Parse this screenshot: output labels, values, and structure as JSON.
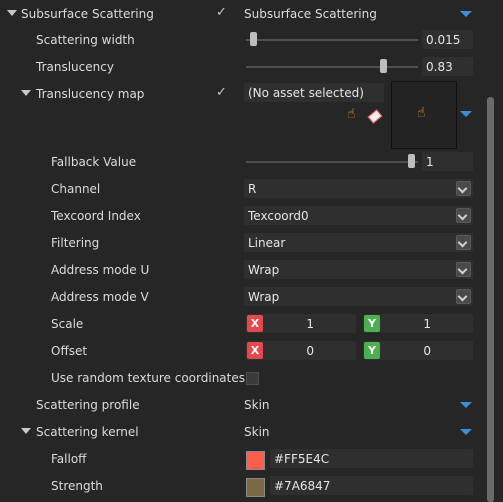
{
  "header": {
    "label": "Subsurface Scattering",
    "dropdown_value": "Subsurface Scattering",
    "checked": true
  },
  "scattering_width": {
    "label": "Scattering width",
    "value": "0.015",
    "slider_fraction": 0.05
  },
  "translucency": {
    "label": "Translucency",
    "value": "0.83",
    "slider_fraction": 0.83
  },
  "translucency_map": {
    "label": "Translucency map",
    "checked": true,
    "asset_text": "(No asset selected)",
    "fallback": {
      "label": "Fallback Value",
      "value": "1",
      "slider_fraction": 1.0
    },
    "channel": {
      "label": "Channel",
      "value": "R"
    },
    "texcoord_index": {
      "label": "Texcoord Index",
      "value": "Texcoord0"
    },
    "filtering": {
      "label": "Filtering",
      "value": "Linear"
    },
    "address_u": {
      "label": "Address mode U",
      "value": "Wrap"
    },
    "address_v": {
      "label": "Address mode V",
      "value": "Wrap"
    },
    "scale": {
      "label": "Scale",
      "x_tag": "X",
      "x": "1",
      "y_tag": "Y",
      "y": "1"
    },
    "offset": {
      "label": "Offset",
      "x_tag": "X",
      "x": "0",
      "y_tag": "Y",
      "y": "0"
    },
    "random_coords": {
      "label": "Use random texture coordinates",
      "checked": false
    }
  },
  "scattering_profile": {
    "label": "Scattering profile",
    "value": "Skin"
  },
  "scattering_kernel": {
    "label": "Scattering kernel",
    "value": "Skin",
    "falloff": {
      "label": "Falloff",
      "hex": "#FF5E4C"
    },
    "strength": {
      "label": "Strength",
      "hex": "#7A6847"
    }
  },
  "colors": {
    "x_tag": "#e5484d",
    "y_tag": "#4caf50",
    "dropdown_arrow": "#3b8fd6"
  }
}
